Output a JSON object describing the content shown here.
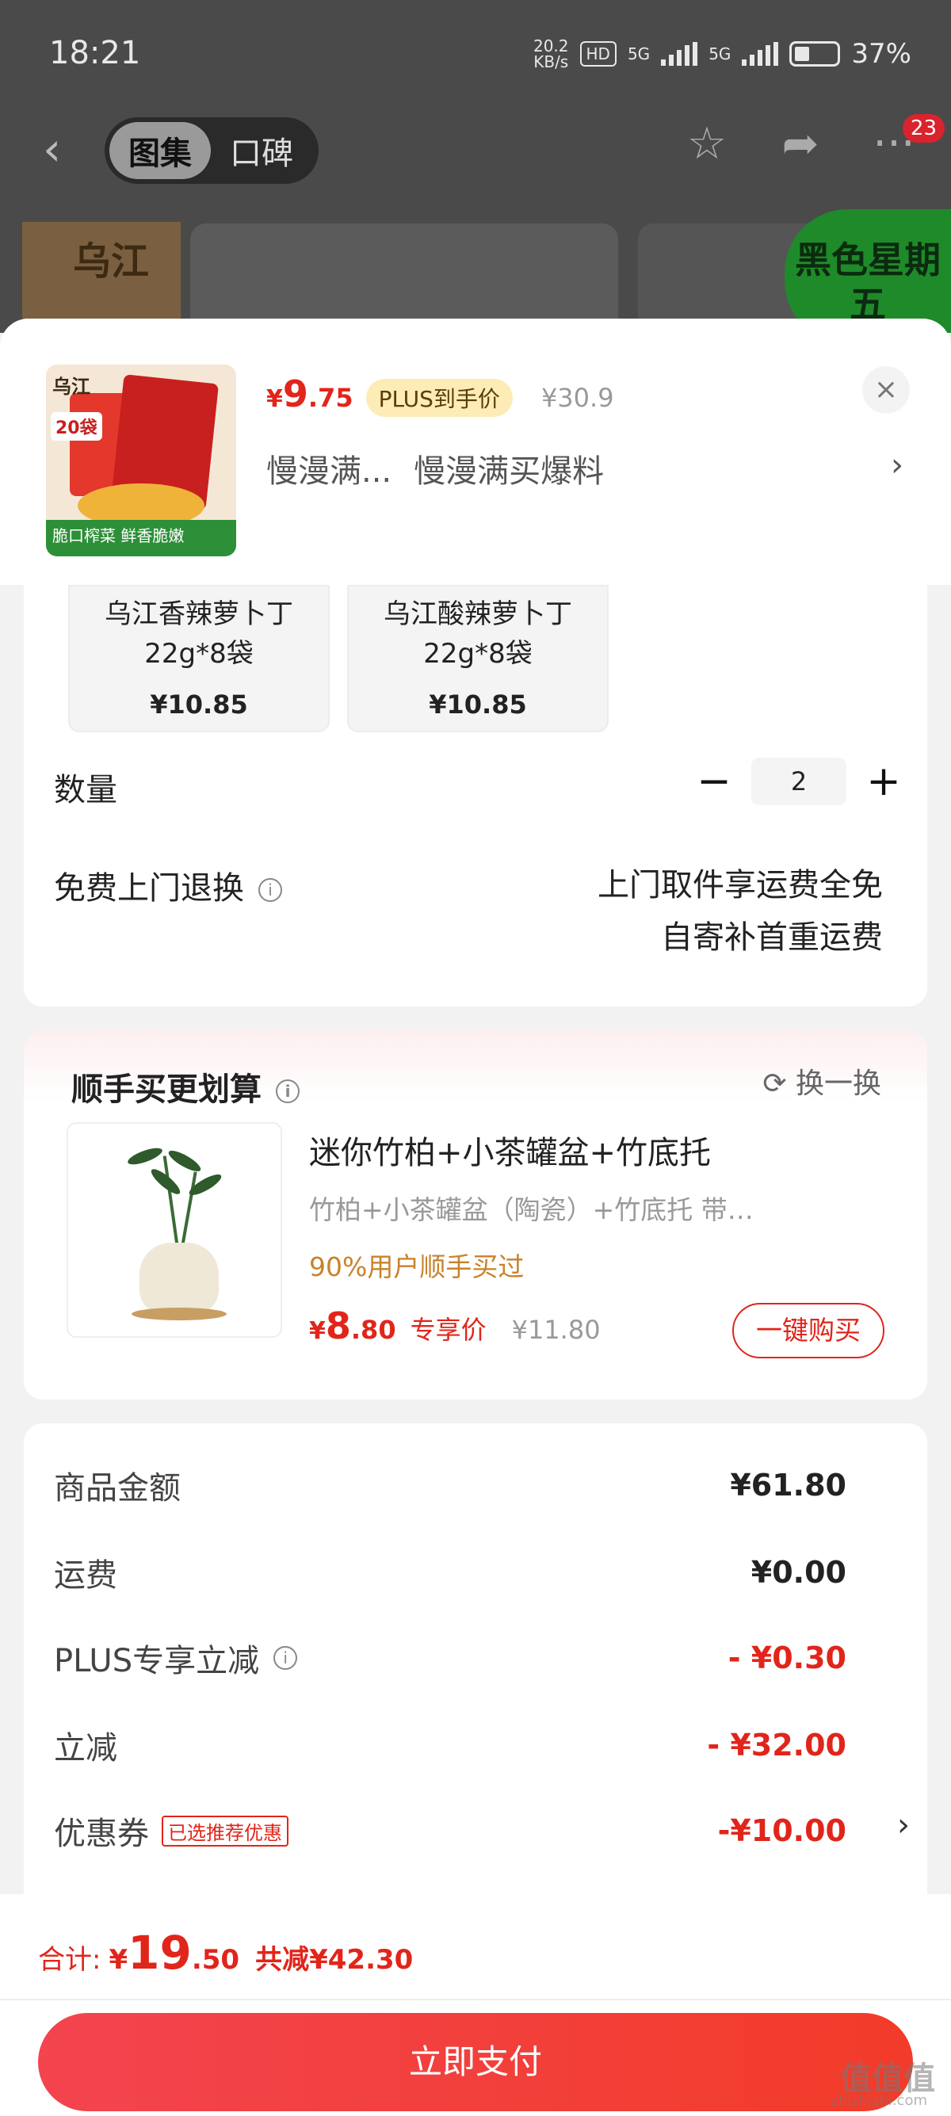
{
  "status_bar": {
    "time": "18:21",
    "net_speed_value": "20.2",
    "net_speed_unit": "KB/s",
    "hd": "HD",
    "sim1": "5G",
    "sim2": "5G",
    "battery": "37%"
  },
  "nav": {
    "back_icon": "chevron-left-icon",
    "tabs": [
      {
        "label": "图集",
        "active": true
      },
      {
        "label": "口碑",
        "active": false
      }
    ],
    "star_icon": "star-icon",
    "share_icon": "share-icon",
    "more_icon": "more-dots-icon",
    "more_badge": "23"
  },
  "background": {
    "brand_logo_text": "乌江",
    "promo_badge": "黑色星期五"
  },
  "product": {
    "price_currency": "¥",
    "price_int": "9",
    "price_dec": ".75",
    "plus_tag": "PLUS到手价",
    "original_price": "¥30.9",
    "promo_1": "慢漫满...",
    "promo_2": "慢漫满买爆料",
    "promo_arrow": "›",
    "close_icon": "×",
    "thumb_logo": "乌江",
    "thumb_tag": "20袋",
    "thumb_strip": "脆口榨菜 鲜香脆嫩"
  },
  "skus": [
    {
      "name_line1": "乌江香辣萝卜丁",
      "name_line2": "22g*8袋",
      "price": "¥10.85"
    },
    {
      "name_line1": "乌江酸辣萝卜丁",
      "name_line2": "22g*8袋",
      "price": "¥10.85"
    }
  ],
  "quantity": {
    "label": "数量",
    "minus": "−",
    "value": "2",
    "plus": "+"
  },
  "returns": {
    "label": "免费上门退换",
    "info_icon": "i",
    "desc_line1": "上门取件享运费全免",
    "desc_line2": "自寄补首重运费"
  },
  "recommend": {
    "title": "顺手买更划算",
    "swap_label": "换一换",
    "item_name": "迷你竹柏+小茶罐盆+竹底托",
    "item_desc": "竹柏+小茶罐盆（陶瓷）+竹底托   带…",
    "item_stat": "90%用户顺手买过",
    "price_currency": "¥",
    "price_int": "8",
    "price_dec": ".80",
    "price_tag": "专享价",
    "original_price": "¥11.80",
    "buy_label": "一键购买"
  },
  "summary": {
    "rows": [
      {
        "label": "商品金额",
        "value": "¥61.80"
      },
      {
        "label": "运费",
        "value": "¥0.00"
      },
      {
        "label": "PLUS专享立减",
        "value": "- ¥0.30"
      },
      {
        "label": "立减",
        "value": "- ¥32.00"
      },
      {
        "label": "优惠券",
        "tag": "已选推荐优惠",
        "value": "-¥10.00"
      }
    ]
  },
  "footer": {
    "total_label": "合计:",
    "total_currency": "¥",
    "total_int": "19",
    "total_dec": ".50",
    "discount_text": "共减¥42.30",
    "pay_label": "立即支付",
    "watermark": "值值值",
    "watermark_sub": "zhizhizhi.com"
  },
  "colors": {
    "accent_red": "#e1251b",
    "plus_gold": "#fdecb5",
    "stat_orange": "#c9822a"
  }
}
